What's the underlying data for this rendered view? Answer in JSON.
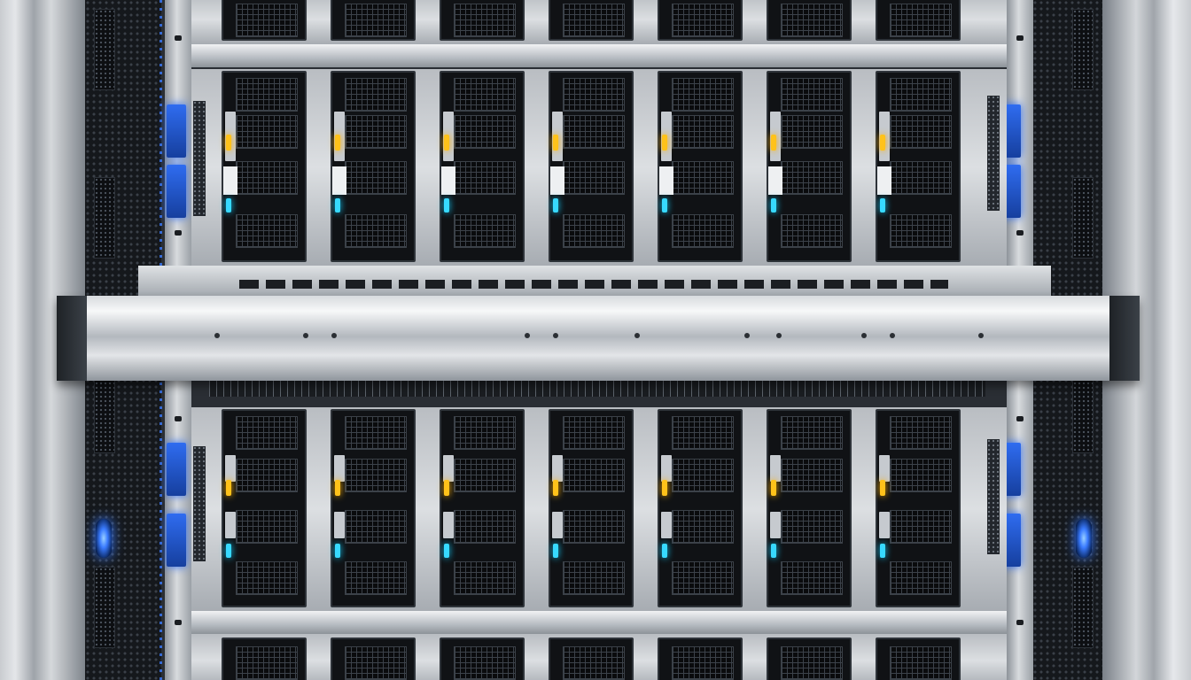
{
  "scene": {
    "subject": "server-rack",
    "colors": {
      "led_amber": "#ffc21a",
      "led_cyan": "#37d9ff",
      "accent_blue": "#2f6cf0",
      "chassis_silver": "#d0d3d7",
      "bay_black": "#101215"
    },
    "upper_row_bays": 7,
    "lower_row_bays": 7
  }
}
